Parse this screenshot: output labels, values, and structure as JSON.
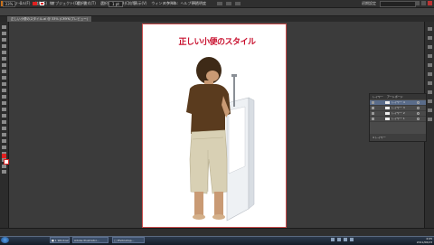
{
  "app": {
    "logo": "Ai"
  },
  "menu": {
    "items": [
      "ファイル(F)",
      "編集(E)",
      "オブジェクト(O)",
      "書式(T)",
      "選択(S)",
      "効果(C)",
      "表示(V)",
      "ウィンドウ(W)",
      "ヘルプ(H)"
    ]
  },
  "workspace": "初期設定",
  "search": {
    "placeholder": ""
  },
  "control": {
    "label": "選択なし",
    "stroke_width": "線:",
    "style_value": "1 pt",
    "uniform": "均等",
    "style_label": "スタイル:",
    "opacity": "不透明度"
  },
  "document": {
    "tab": "正しい小便のスタイル.ai @ 33% (CMYK/プレビュー)"
  },
  "artboard": {
    "title": "正しい小便のスタイル",
    "figure": "boy-at-urinal"
  },
  "layers": {
    "tabs": [
      "レイヤー",
      "アートボード"
    ],
    "rows": [
      {
        "name": "レイヤー 4",
        "selected": true
      },
      {
        "name": "レイヤー 3",
        "selected": false
      },
      {
        "name": "レイヤー 2",
        "selected": false
      },
      {
        "name": "レイヤー 1",
        "selected": false
      }
    ],
    "footer": "4 レイヤー"
  },
  "status": {
    "zoom": "33%",
    "page": "1",
    "text": "選択"
  },
  "taskbar": {
    "items": [
      {
        "label": "■ 1 Windows..."
      },
      {
        "label": "Adobe Illustrator..."
      },
      {
        "label": "□ Photoshop..."
      }
    ],
    "time": "4:05",
    "date": "2011/06/23"
  },
  "colors": {
    "accent_red": "#c8102e",
    "fill": "#e02020",
    "artboard_border": "#c84b4b"
  }
}
